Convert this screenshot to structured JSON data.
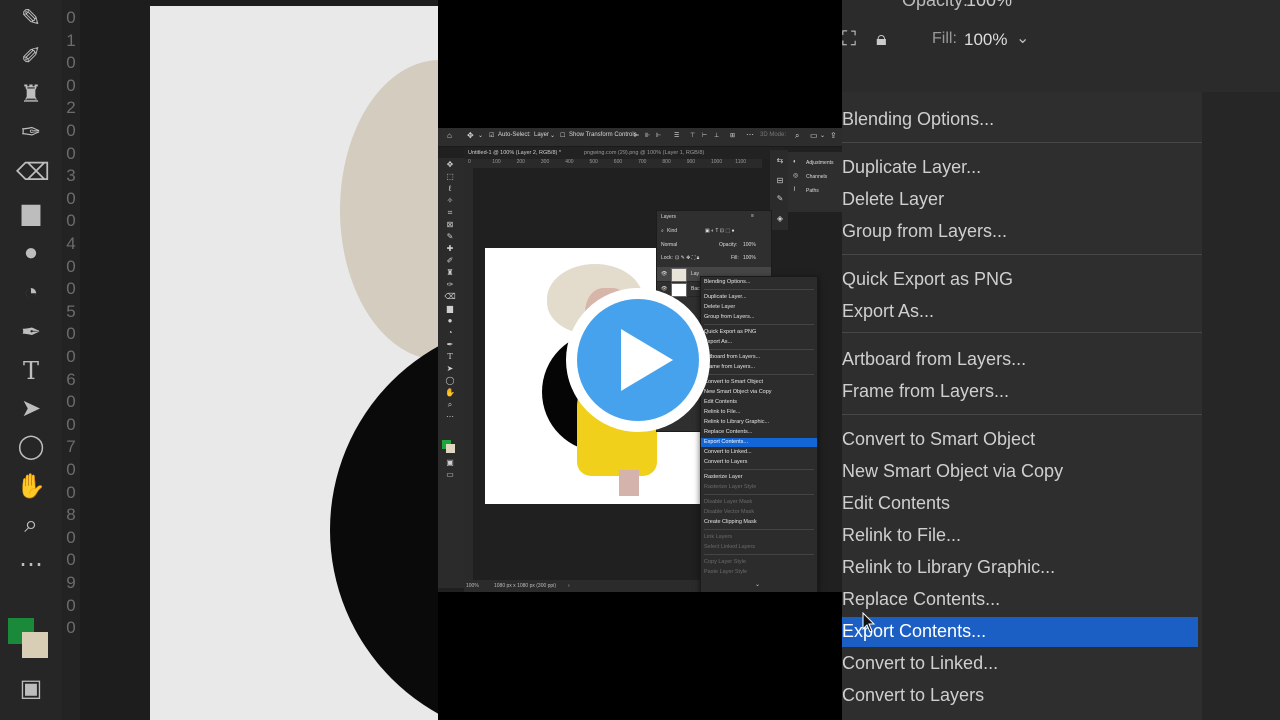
{
  "bg_left": {
    "ruler_digits": [
      "0",
      "1",
      "0",
      "0",
      "2",
      "0",
      "0",
      "3",
      "0",
      "0",
      "4",
      "0",
      "0",
      "5",
      "0",
      "0",
      "6",
      "0",
      "0",
      "7",
      "0",
      "0",
      "8",
      "0",
      "0",
      "9",
      "0",
      "0"
    ]
  },
  "bg_right": {
    "opacity_label": "Opacity:",
    "opacity_value": "100%",
    "fill_label": "Fill:",
    "fill_value": "100%",
    "menu": [
      {
        "label": "Blending Options...",
        "state": "normal"
      },
      {
        "label": "Duplicate Layer...",
        "state": "normal"
      },
      {
        "label": "Delete Layer",
        "state": "normal"
      },
      {
        "label": "Group from Layers...",
        "state": "normal"
      },
      {
        "label": "Quick Export as PNG",
        "state": "normal"
      },
      {
        "label": "Export As...",
        "state": "normal"
      },
      {
        "label": "Artboard from Layers...",
        "state": "normal"
      },
      {
        "label": "Frame from Layers...",
        "state": "normal"
      },
      {
        "label": "Convert to Smart Object",
        "state": "normal"
      },
      {
        "label": "New Smart Object via Copy",
        "state": "normal"
      },
      {
        "label": "Edit Contents",
        "state": "normal"
      },
      {
        "label": "Relink to File...",
        "state": "normal"
      },
      {
        "label": "Relink to Library Graphic...",
        "state": "normal"
      },
      {
        "label": "Replace Contents...",
        "state": "normal"
      },
      {
        "label": "Export Contents...",
        "state": "selected"
      },
      {
        "label": "Convert to Linked...",
        "state": "normal"
      },
      {
        "label": "Convert to Layers",
        "state": "normal"
      }
    ]
  },
  "photoshop": {
    "options_bar": {
      "auto_select_label": "Auto-Select:",
      "auto_select_value": "Layer",
      "show_transform_label": "Show Transform Controls",
      "mode_3d_label": "3D Mode:"
    },
    "tabs": [
      "Untitled-1 @ 100% (Layer 2, RGB/8) *",
      "pngwing.com (29).png @ 100% (Layer 1, RGB/8)"
    ],
    "ruler_ticks": [
      "0",
      "100",
      "200",
      "300",
      "400",
      "500",
      "600",
      "700",
      "800",
      "900",
      "1000",
      "1100"
    ],
    "status": {
      "zoom": "100%",
      "doc_info": "1080 px x 1080 px (300 ppi)"
    },
    "panels": [
      "Adjustments",
      "Channels",
      "Paths"
    ],
    "layers_panel": {
      "title": "Layers",
      "filter_label": "Kind",
      "blend_mode": "Normal",
      "opacity_label": "Opacity:",
      "opacity_value": "100%",
      "lock_label": "Lock:",
      "fill_label": "Fill:",
      "fill_value": "100%",
      "layer_names": [
        "Lay",
        "Bac"
      ]
    },
    "context_menu": [
      {
        "label": "Blending Options...",
        "state": "normal"
      },
      {
        "label": "Duplicate Layer...",
        "state": "normal"
      },
      {
        "label": "Delete Layer",
        "state": "normal"
      },
      {
        "label": "Group from Layers...",
        "state": "normal"
      },
      {
        "label": "Quick Export as PNG",
        "state": "normal"
      },
      {
        "label": "Export As...",
        "state": "normal"
      },
      {
        "label": "Artboard from Layers...",
        "state": "normal"
      },
      {
        "label": "Frame from Layers...",
        "state": "normal"
      },
      {
        "label": "Convert to Smart Object",
        "state": "normal"
      },
      {
        "label": "New Smart Object via Copy",
        "state": "normal"
      },
      {
        "label": "Edit Contents",
        "state": "normal"
      },
      {
        "label": "Relink to File...",
        "state": "normal"
      },
      {
        "label": "Relink to Library Graphic...",
        "state": "normal"
      },
      {
        "label": "Replace Contents...",
        "state": "normal"
      },
      {
        "label": "Export Contents...",
        "state": "selected"
      },
      {
        "label": "Convert to Linked...",
        "state": "normal"
      },
      {
        "label": "Convert to Layers",
        "state": "normal"
      },
      {
        "label": "Rasterize Layer",
        "state": "normal"
      },
      {
        "label": "Rasterize Layer Style",
        "state": "disabled"
      },
      {
        "label": "Disable Layer Mask",
        "state": "disabled"
      },
      {
        "label": "Disable Vector Mask",
        "state": "disabled"
      },
      {
        "label": "Create Clipping Mask",
        "state": "normal"
      },
      {
        "label": "Link Layers",
        "state": "disabled"
      },
      {
        "label": "Select Linked Layers",
        "state": "disabled"
      },
      {
        "label": "Copy Layer Style",
        "state": "disabled"
      },
      {
        "label": "Paste Layer Style",
        "state": "disabled"
      }
    ]
  },
  "overlay": {
    "play_icon": "play-icon",
    "accent_color": "#47a2ee",
    "selection_color": "#1366d6"
  }
}
